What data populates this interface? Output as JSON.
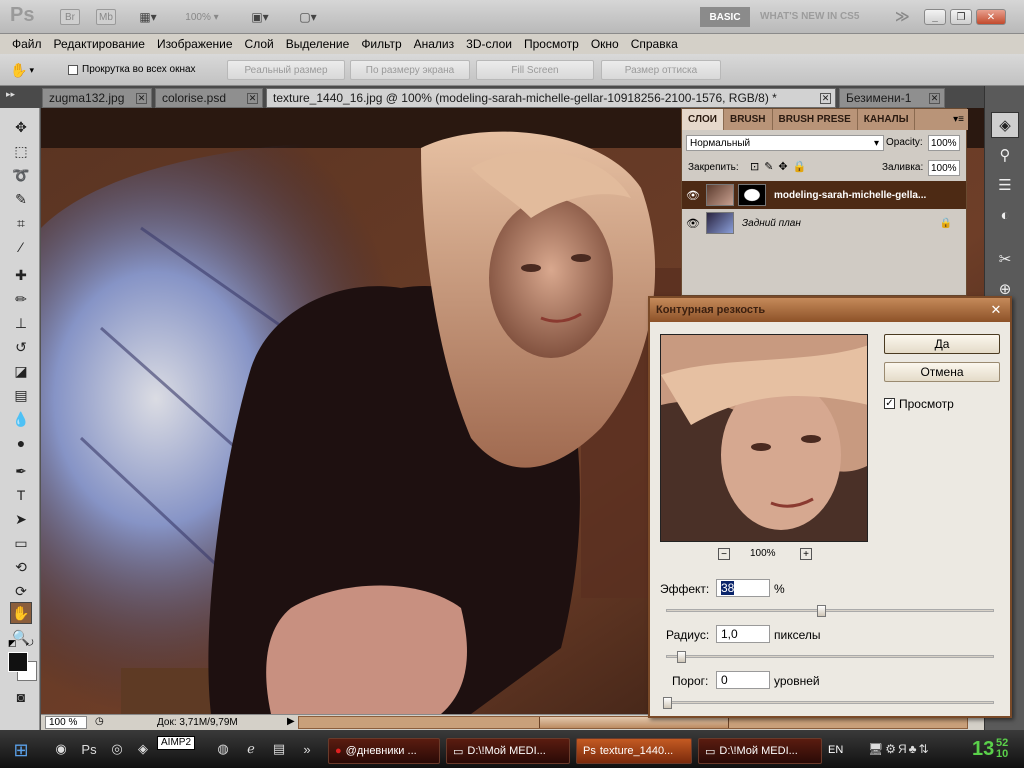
{
  "appbar": {
    "logo": "Ps",
    "br": "Br",
    "mb": "Mb",
    "zoom": "100%",
    "workspace_basic": "BASIC",
    "workspace_new": "WHAT'S NEW IN CS5",
    "workspace_more": "≫"
  },
  "menu": [
    "Файл",
    "Редактирование",
    "Изображение",
    "Слой",
    "Выделение",
    "Фильтр",
    "Анализ",
    "3D-слои",
    "Просмотр",
    "Окно",
    "Справка"
  ],
  "options": {
    "scroll_all": "Прокрутка во всех окнах",
    "btn_actual": "Реальный размер",
    "btn_fit": "По размеру экрана",
    "btn_fill": "Fill Screen",
    "btn_print": "Размер оттиска"
  },
  "tabs": [
    {
      "label": "zugma132.jpg"
    },
    {
      "label": "colorise.psd"
    },
    {
      "label": "texture_1440_16.jpg @ 100% (modeling-sarah-michelle-gellar-10918256-2100-1576, RGB/8) *"
    },
    {
      "label": "Безимени-1"
    }
  ],
  "status": {
    "zoom": "100 %",
    "doc": "Док: 3,71M/9,79M"
  },
  "layers_panel": {
    "tabs": [
      "СЛОИ",
      "BRUSH",
      "BRUSH PRESE",
      "КАНАЛЫ"
    ],
    "blend_mode": "Нормальный",
    "opacity_label": "Opacity:",
    "opacity": "100%",
    "lock_label": "Закрепить:",
    "fill_label": "Заливка:",
    "fill": "100%",
    "layers": [
      {
        "name": "modeling-sarah-michelle-gella..."
      },
      {
        "name": "Задний план"
      }
    ]
  },
  "dialog": {
    "title": "Контурная резкость",
    "ok": "Да",
    "cancel": "Отмена",
    "preview_label": "Просмотр",
    "preview_checked": true,
    "zoom_pct": "100%",
    "effect_label": "Эффект:",
    "effect_value": "38",
    "effect_unit": "%",
    "radius_label": "Радиус:",
    "radius_value": "1,0",
    "radius_unit": "пикселы",
    "threshold_label": "Порог:",
    "threshold_value": "0",
    "threshold_unit": "уровней"
  },
  "taskbar": {
    "tooltip": "AIMP2",
    "buttons": [
      {
        "label": "@дневники ..."
      },
      {
        "label": "D:\\!Мой MEDI..."
      },
      {
        "label": "texture_1440..."
      },
      {
        "label": "D:\\!Мой MEDI..."
      }
    ],
    "lang": "EN",
    "clock_hour": "13",
    "clock_min_top": "52",
    "clock_min_bot": "10"
  }
}
